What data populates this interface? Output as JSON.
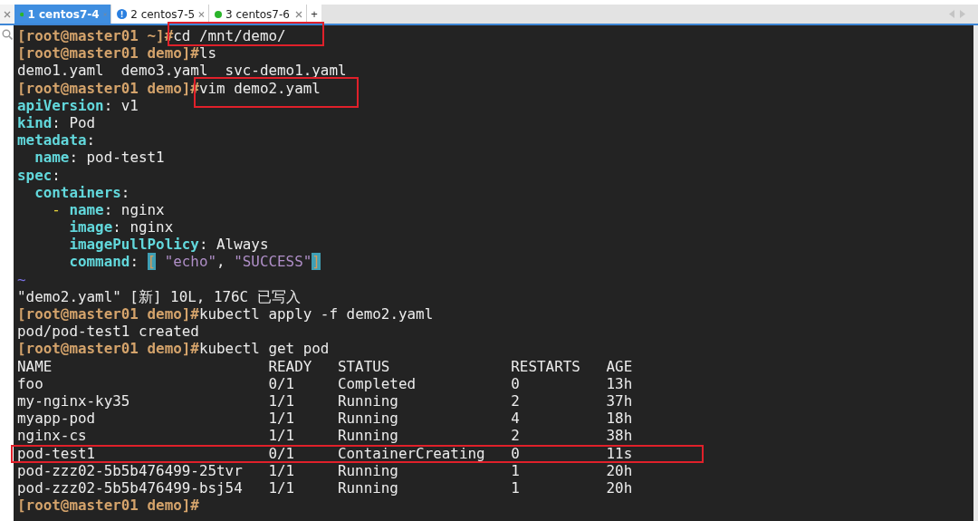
{
  "tabs": [
    {
      "label": "1 centos7-4",
      "selected": true,
      "kind": "connected"
    },
    {
      "label": "2 centos7-5",
      "selected": false,
      "kind": "alert"
    },
    {
      "label": "3 centos7-6",
      "selected": false,
      "kind": "connected"
    }
  ],
  "new_tab": "+",
  "terminal": {
    "lines": [
      {
        "boxed": true,
        "segments": [
          {
            "kind": "prompt",
            "text": "[root@master01 ~]#"
          },
          {
            "kind": "plain",
            "text": "cd /mnt/demo/"
          }
        ]
      },
      {
        "boxed": false,
        "segments": [
          {
            "kind": "prompt",
            "text": "[root@master01 demo]#"
          },
          {
            "kind": "plain",
            "text": "ls"
          }
        ]
      },
      {
        "boxed": false,
        "segments": [
          {
            "kind": "plain",
            "text": "demo1.yaml  demo3.yaml  svc-demo1.yaml"
          }
        ]
      },
      {
        "boxed": true,
        "segments": [
          {
            "kind": "prompt",
            "text": "[root@master01 demo]#"
          },
          {
            "kind": "plain",
            "text": "vim demo2.yaml"
          }
        ]
      },
      {
        "boxed": false,
        "segments": [
          {
            "kind": "key",
            "text": "apiVersion"
          },
          {
            "kind": "plain",
            "text": ": v1"
          }
        ]
      },
      {
        "boxed": false,
        "segments": [
          {
            "kind": "key",
            "text": "kind"
          },
          {
            "kind": "plain",
            "text": ": Pod"
          }
        ]
      },
      {
        "boxed": false,
        "segments": [
          {
            "kind": "key",
            "text": "metadata"
          },
          {
            "kind": "plain",
            "text": ":"
          }
        ]
      },
      {
        "boxed": false,
        "segments": [
          {
            "kind": "key",
            "text": "  name"
          },
          {
            "kind": "plain",
            "text": ": pod-test1"
          }
        ]
      },
      {
        "boxed": false,
        "segments": [
          {
            "kind": "key",
            "text": "spec"
          },
          {
            "kind": "plain",
            "text": ":"
          }
        ]
      },
      {
        "boxed": false,
        "segments": [
          {
            "kind": "key",
            "text": "  containers"
          },
          {
            "kind": "plain",
            "text": ":"
          }
        ]
      },
      {
        "boxed": false,
        "segments": [
          {
            "kind": "dash",
            "text": "    -"
          },
          {
            "kind": "key",
            "text": " name"
          },
          {
            "kind": "plain",
            "text": ": nginx"
          }
        ]
      },
      {
        "boxed": false,
        "segments": [
          {
            "kind": "key",
            "text": "      image"
          },
          {
            "kind": "plain",
            "text": ": nginx"
          }
        ]
      },
      {
        "boxed": false,
        "segments": [
          {
            "kind": "key",
            "text": "      imagePullPolicy"
          },
          {
            "kind": "plain",
            "text": ": Always"
          }
        ]
      },
      {
        "boxed": false,
        "segments": [
          {
            "kind": "key",
            "text": "      command"
          },
          {
            "kind": "plain",
            "text": ": "
          },
          {
            "kind": "bracket",
            "text": "["
          },
          {
            "kind": "string",
            "text": " \"echo\""
          },
          {
            "kind": "plain",
            "text": ", "
          },
          {
            "kind": "string",
            "text": "\"SUCCESS\""
          },
          {
            "kind": "bracket",
            "text": "]"
          }
        ]
      },
      {
        "boxed": false,
        "segments": [
          {
            "kind": "tilde",
            "text": "~"
          }
        ]
      },
      {
        "boxed": false,
        "segments": [
          {
            "kind": "plain",
            "text": "\"demo2.yaml\" [新] 10L, 176C 已写入"
          }
        ]
      },
      {
        "boxed": false,
        "segments": [
          {
            "kind": "prompt",
            "text": "[root@master01 demo]#"
          },
          {
            "kind": "plain",
            "text": "kubectl apply -f demo2.yaml"
          }
        ]
      },
      {
        "boxed": false,
        "segments": [
          {
            "kind": "plain",
            "text": "pod/pod-test1 created"
          }
        ]
      },
      {
        "boxed": false,
        "segments": [
          {
            "kind": "prompt",
            "text": "[root@master01 demo]#"
          },
          {
            "kind": "plain",
            "text": "kubectl get pod"
          }
        ]
      }
    ],
    "table": {
      "columns": [
        "NAME",
        "READY",
        "STATUS",
        "RESTARTS",
        "AGE"
      ],
      "rows": [
        {
          "boxed": false,
          "cells": [
            "foo",
            "0/1",
            "Completed",
            "0",
            "13h"
          ]
        },
        {
          "boxed": false,
          "cells": [
            "my-nginx-ky35",
            "1/1",
            "Running",
            "2",
            "37h"
          ]
        },
        {
          "boxed": false,
          "cells": [
            "myapp-pod",
            "1/1",
            "Running",
            "4",
            "18h"
          ]
        },
        {
          "boxed": false,
          "cells": [
            "nginx-cs",
            "1/1",
            "Running",
            "2",
            "38h"
          ]
        },
        {
          "boxed": true,
          "cells": [
            "pod-test1",
            "0/1",
            "ContainerCreating",
            "0",
            "11s"
          ]
        },
        {
          "boxed": false,
          "cells": [
            "pod-zzz02-5b5b476499-25tvr",
            "1/1",
            "Running",
            "1",
            "20h"
          ]
        },
        {
          "boxed": false,
          "cells": [
            "pod-zzz02-5b5b476499-bsj54",
            "1/1",
            "Running",
            "1",
            "20h"
          ]
        }
      ]
    },
    "final_prompt": "[root@master01 demo]#"
  }
}
